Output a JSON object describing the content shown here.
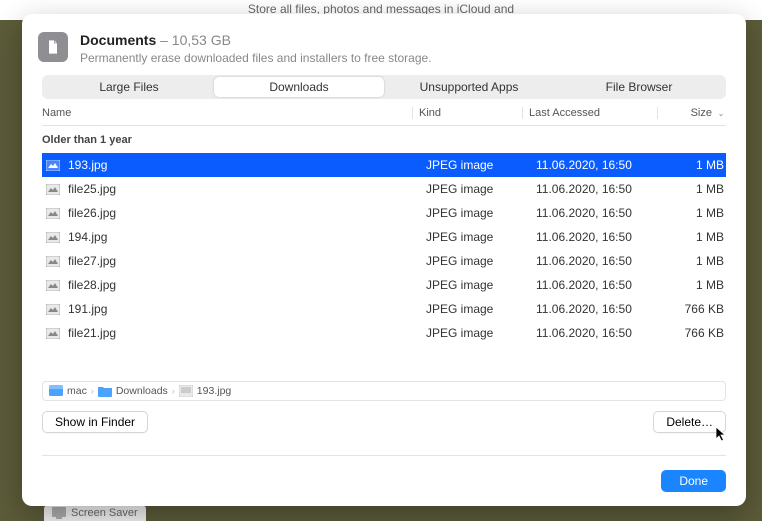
{
  "background_hint": "Store all files, photos and messages in iCloud and",
  "header": {
    "title": "Documents",
    "size_suffix": " – 10,53 GB",
    "subtitle": "Permanently erase downloaded files and installers to free storage."
  },
  "tabs": [
    {
      "label": "Large Files",
      "active": false
    },
    {
      "label": "Downloads",
      "active": true
    },
    {
      "label": "Unsupported Apps",
      "active": false
    },
    {
      "label": "File Browser",
      "active": false
    }
  ],
  "columns": {
    "name": "Name",
    "kind": "Kind",
    "last_accessed": "Last Accessed",
    "size": "Size"
  },
  "group_label": "Older than 1 year",
  "files": [
    {
      "name": "193.jpg",
      "kind": "JPEG image",
      "date": "11.06.2020, 16:50",
      "size": "1 MB",
      "selected": true
    },
    {
      "name": "file25.jpg",
      "kind": "JPEG image",
      "date": "11.06.2020, 16:50",
      "size": "1 MB",
      "selected": false
    },
    {
      "name": "file26.jpg",
      "kind": "JPEG image",
      "date": "11.06.2020, 16:50",
      "size": "1 MB",
      "selected": false
    },
    {
      "name": "194.jpg",
      "kind": "JPEG image",
      "date": "11.06.2020, 16:50",
      "size": "1 MB",
      "selected": false
    },
    {
      "name": "file27.jpg",
      "kind": "JPEG image",
      "date": "11.06.2020, 16:50",
      "size": "1 MB",
      "selected": false
    },
    {
      "name": "file28.jpg",
      "kind": "JPEG image",
      "date": "11.06.2020, 16:50",
      "size": "1 MB",
      "selected": false
    },
    {
      "name": "191.jpg",
      "kind": "JPEG image",
      "date": "11.06.2020, 16:50",
      "size": "766 KB",
      "selected": false
    },
    {
      "name": "file21.jpg",
      "kind": "JPEG image",
      "date": "11.06.2020, 16:50",
      "size": "766 KB",
      "selected": false
    }
  ],
  "breadcrumb": {
    "root": "mac",
    "folder": "Downloads",
    "file": "193.jpg"
  },
  "buttons": {
    "show_in_finder": "Show in Finder",
    "delete": "Delete…",
    "done": "Done"
  },
  "behind_app": "Screen Saver"
}
